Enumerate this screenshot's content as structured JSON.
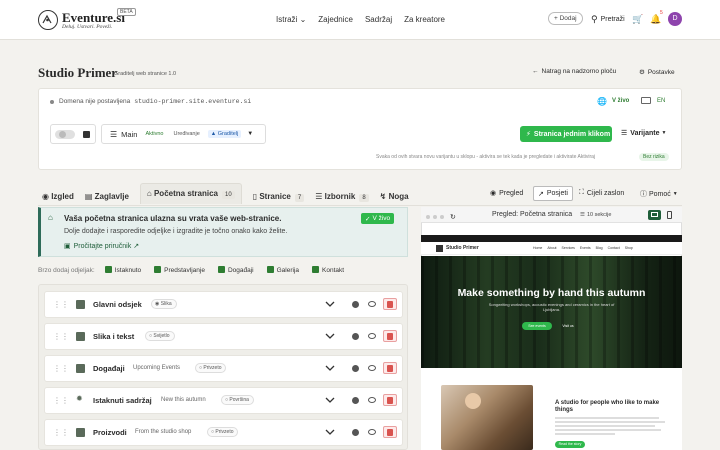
{
  "header": {
    "brand": "Eventure.si",
    "beta": "BETA",
    "tagline": "Deluj. Ustvari. Poveži.",
    "nav": [
      "Istraži",
      "Zajednice",
      "Sadržaj",
      "Za kreatore"
    ],
    "add_label": "+ Dodaj",
    "search_label": "Pretraži",
    "notif_count": "5",
    "avatar_letter": "D"
  },
  "page": {
    "title": "Studio Primer",
    "subtitle": "Graditelj web stranice 1.0",
    "back_label": "Natrag na nadzorno ploču",
    "settings_label": "Postavke"
  },
  "domain_bar": {
    "text": "Domena nije postavljena",
    "domain": "studio-primer.site.eventure.si",
    "status": "V živo",
    "lang": "EN"
  },
  "branch": {
    "label": "Main",
    "modes": [
      "Aktivno",
      "Uređivanje",
      "Graditelj"
    ],
    "publish_label": "Stranica jednim klikom",
    "variants_label": "Varijante",
    "note": "Svaka od ovih stvara novu varijantu u sklopu - aktivira se tek kada je pregledate i aktivirate Aktiviraj",
    "note_badge": "Bez rizika"
  },
  "tabs": [
    {
      "label": "Izgled",
      "count": ""
    },
    {
      "label": "Zaglavlje",
      "count": ""
    },
    {
      "label": "Početna stranica",
      "count": "10"
    },
    {
      "label": "Stranice",
      "count": "7"
    },
    {
      "label": "Izbornik",
      "count": "8"
    },
    {
      "label": "Noga",
      "count": ""
    }
  ],
  "view_controls": {
    "preview": "Pregled",
    "visit": "Posjeti",
    "fullscreen": "Cijeli zaslon",
    "help": "Pomoć"
  },
  "info": {
    "title": "Vaša početna stranica ulazna su vrata vaše web-stranice.",
    "text": "Dolje dodajte i rasporedite odjeljke i izgradite je točno onako kako želite.",
    "link": "Pročitajte priručnik",
    "status": "V živo"
  },
  "quick_add": {
    "label": "Brzo dodaj odjeljak:",
    "items": [
      "Istaknuto",
      "Predstavljanje",
      "Događaji",
      "Galerija",
      "Kontakt"
    ]
  },
  "sections": [
    {
      "name": "Glavni odsjek",
      "sub": "",
      "tag": "Slika"
    },
    {
      "name": "Slika i tekst",
      "sub": "",
      "tag": "Svijetlo"
    },
    {
      "name": "Događaji",
      "sub": "Upcoming Events",
      "tag": "Privzeto"
    },
    {
      "name": "Istaknuti sadržaj",
      "sub": "New this autumn",
      "tag": "Površina"
    },
    {
      "name": "Proizvodi",
      "sub": "From the studio shop",
      "tag": "Privzeto"
    }
  ],
  "preview": {
    "title": "Pregled: Početna stranica",
    "sections_count": "10 sekcije",
    "site_name": "Studio Primer",
    "site_nav": [
      "Home",
      "About",
      "Services",
      "Events",
      "Blog",
      "Contact",
      "Shop"
    ],
    "hero_title": "Make something by hand this autumn",
    "hero_text": "Songwriting workshops, acoustic evenings and ceramics in the heart of Ljubljana.",
    "hero_cta1": "See events",
    "hero_cta2": "Visit us",
    "card_title": "A studio for people who like to make things",
    "card_cta": "Read the story"
  },
  "colors": {
    "accent_green": "#2fb84c",
    "dark_green": "#1f5e3a",
    "avatar_purple": "#8e44ad"
  }
}
